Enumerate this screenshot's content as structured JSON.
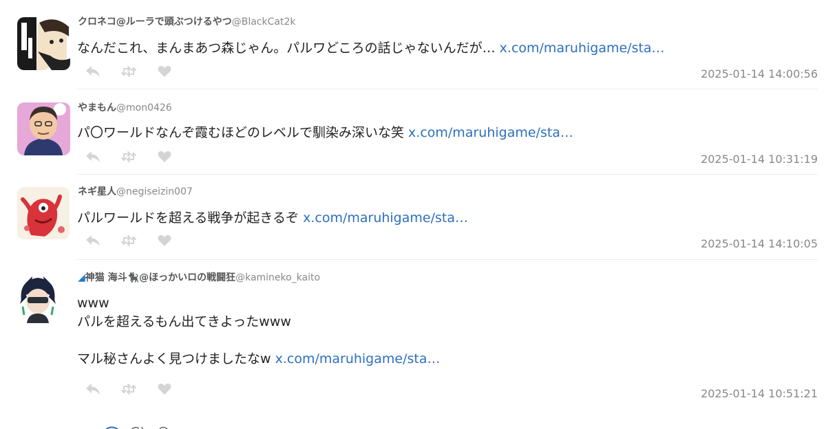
{
  "tweets": [
    {
      "display_name": "クロネコ@ルーラで頭ぶつけるやつ",
      "handle": "@BlackCat2k",
      "text": "なんだこれ、まんまあつ森じゃん。パルワどころの話じゃないんだが… ",
      "link": "x.com/maruhigame/sta…",
      "timestamp": "2025-01-14 14:00:56",
      "avatar_icon": "manga-character-avatar-icon"
    },
    {
      "display_name": "やまもん",
      "handle": "@mon0426",
      "text": "パ〇ワールドなんぞ霞むほどのレベルで馴染み深いな笑 ",
      "link": "x.com/maruhigame/sta…",
      "timestamp": "2025-01-14 10:31:19",
      "avatar_icon": "cartoon-man-avatar-icon"
    },
    {
      "display_name": "ネギ星人",
      "handle": "@negiseizin007",
      "text": "パルワールドを超える戦争が起きるぞ ",
      "link": "x.com/maruhigame/sta…",
      "timestamp": "2025-01-14 14:10:05",
      "avatar_icon": "red-creature-avatar-icon"
    },
    {
      "wave_prefix": "◢",
      "display_name": "神猫 海斗🐈‍⬛@ほっかいロの戦闘狂",
      "handle": "@kamineko_kaito",
      "text": "www\nパルを超えるもん出てきよったwww\n\nマル秘さんよく見つけましたなw ",
      "link": "x.com/maruhigame/sta…",
      "timestamp": "2025-01-14 10:51:21",
      "avatar_icon": "anime-character-avatar-icon"
    }
  ],
  "action_icons": [
    "reply-icon",
    "retweet-icon",
    "like-icon"
  ],
  "colors": {
    "link": "#2c6fbf",
    "meta": "#888888",
    "icon": "#d4d4d4",
    "divider": "#ececec"
  }
}
